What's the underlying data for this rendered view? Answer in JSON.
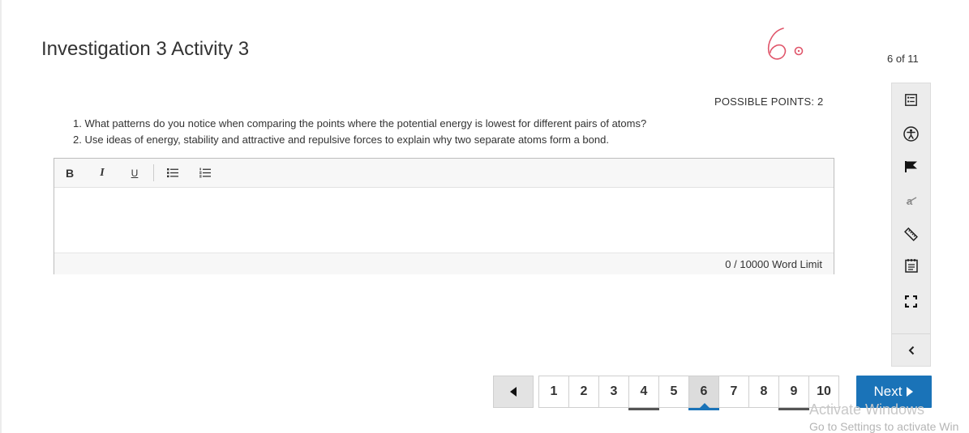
{
  "header": {
    "title": "Investigation 3 Activity 3",
    "progress": "6 of 11"
  },
  "question": {
    "possible_points": "POSSIBLE POINTS: 2",
    "items": [
      "1. What patterns do you notice when comparing the points where the potential energy is lowest for different pairs of atoms?",
      "2. Use ideas of energy, stability and attractive and repulsive forces to explain why two separate atoms form a bond."
    ]
  },
  "editor": {
    "toolbar": {
      "bold": "B",
      "italic": "I",
      "underline": "U"
    },
    "value": "",
    "word_limit": "0 / 10000 Word Limit"
  },
  "toolbox": {
    "icons": [
      "question-list-icon",
      "accessibility-icon",
      "flag-icon",
      "strikethrough-icon",
      "ruler-icon",
      "notepad-icon",
      "fullscreen-icon",
      "collapse-icon"
    ]
  },
  "pagination": {
    "pages": [
      "1",
      "2",
      "3",
      "4",
      "5",
      "6",
      "7",
      "8",
      "9",
      "10"
    ],
    "current": "6",
    "answered": [
      "4",
      "9"
    ],
    "next_label": "Next"
  },
  "watermark": {
    "line1": "Activate Windows",
    "line2": "Go to Settings to activate Win"
  },
  "colors": {
    "accent": "#1a73b8",
    "handwriting": "#e0556a"
  }
}
